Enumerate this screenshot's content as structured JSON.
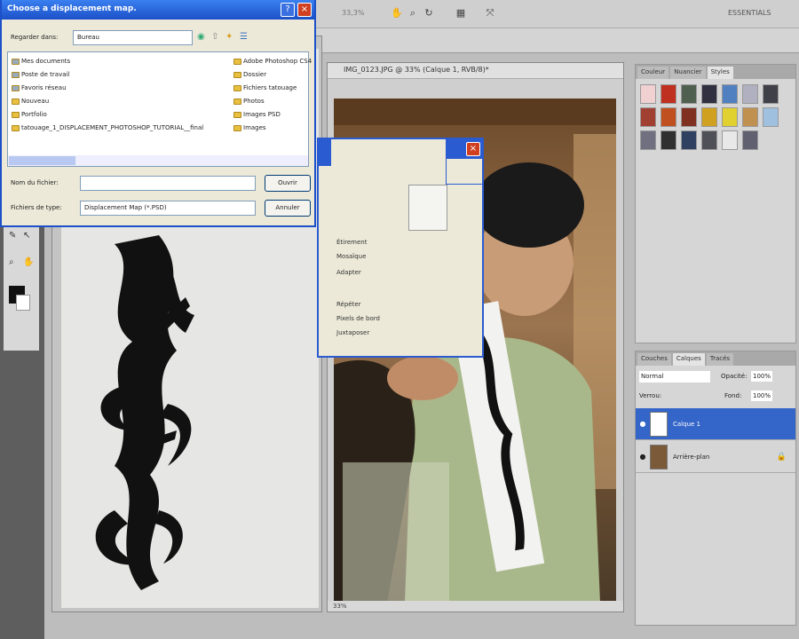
{
  "app": {
    "workspace": "ESSENTIALS",
    "zoom": "33,3%"
  },
  "doc2": {
    "title": "IMG_0123.JPG @ 33% (Calque 1, RVB/8)*",
    "status": "33%"
  },
  "right_panel": {
    "tabs": [
      "Couleur",
      "Nuancier",
      "Styles"
    ]
  },
  "layers": {
    "tabs": [
      "Couches",
      "Calques",
      "Tracés"
    ],
    "blend": "Normal",
    "opacity_label": "Opacité:",
    "opacity": "100%",
    "lock_label": "Verrou:",
    "fill_label": "Fond:",
    "fill": "100%",
    "items": [
      {
        "name": "Calque 1",
        "selected": true
      },
      {
        "name": "Arrière-plan",
        "selected": false
      }
    ]
  },
  "dialog": {
    "title": "Choose a displacement map.",
    "look_in_label": "Regarder dans:",
    "look_in": "Bureau",
    "left_items": [
      "Mes documents",
      "Poste de travail",
      "Favoris réseau",
      "Nouveau",
      "Portfolio",
      "tatouage_1_DISPLACEMENT_PHOTOSHOP_TUTORIAL__final"
    ],
    "right_items": [
      "Adobe Photoshop CS4",
      "Dossier",
      "Fichiers tatouage",
      "Photos",
      "Images PSD",
      "Images"
    ],
    "filename_label": "Nom du fichier:",
    "filename": "",
    "filetype_label": "Fichiers de type:",
    "filetype": "Displacement Map (*.PSD)",
    "open": "Ouvrir",
    "cancel": "Annuler"
  },
  "displace_dialog": {
    "options": [
      "Étirement",
      "Mosaïque",
      "Répéter",
      "Pixels de bord"
    ],
    "labels": [
      "Adapter",
      "Juxtaposer"
    ]
  }
}
